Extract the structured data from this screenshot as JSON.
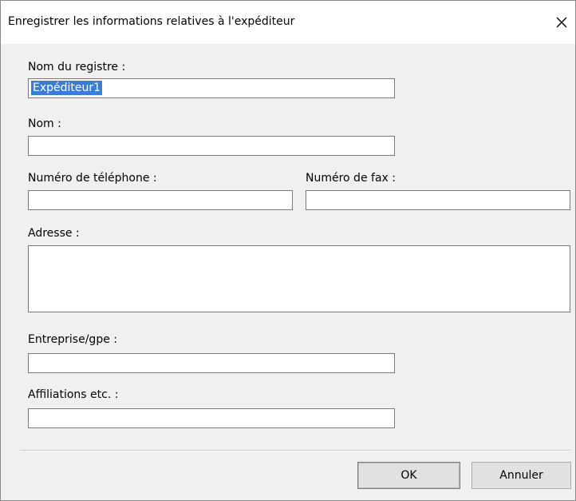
{
  "window": {
    "title": "Enregistrer les informations relatives à l'expéditeur",
    "close_icon": "close-icon"
  },
  "form": {
    "registry_name": {
      "label": "Nom du registre :",
      "value": "Expéditeur1"
    },
    "name": {
      "label": "Nom :",
      "value": ""
    },
    "phone": {
      "label": "Numéro de téléphone :",
      "value": ""
    },
    "fax": {
      "label": "Numéro de fax :",
      "value": ""
    },
    "address": {
      "label": "Adresse :",
      "value": ""
    },
    "company": {
      "label": "Entreprise/gpe :",
      "value": ""
    },
    "affiliations": {
      "label": "Affiliations etc. :",
      "value": ""
    }
  },
  "buttons": {
    "ok_label": "OK",
    "cancel_label": "Annuler"
  }
}
